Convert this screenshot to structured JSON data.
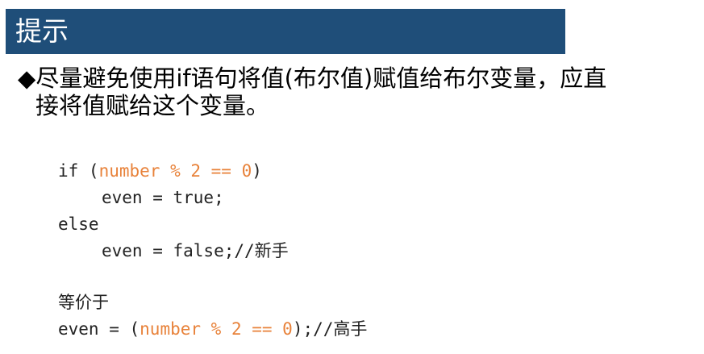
{
  "header": {
    "title": "提示"
  },
  "tip": {
    "bullet": "◆",
    "line1": "尽量避免使用if语句将值(布尔值)赋值给布尔变量，应直",
    "line2": "接将值赋给这个变量。"
  },
  "code_block_1": {
    "if_keyword": "if (",
    "if_condition": "number % 2 == 0",
    "if_close": ")",
    "then_statement": "even = true;",
    "else_keyword": "else",
    "else_statement": "even = false;//新手"
  },
  "code_block_2": {
    "equiv_label": "等价于",
    "expr_prefix": "even = (",
    "expr_condition": "number % 2 == 0",
    "expr_suffix": ");//高手"
  },
  "colors": {
    "header_bg": "#1f4e79",
    "highlight": "#e8823a"
  }
}
